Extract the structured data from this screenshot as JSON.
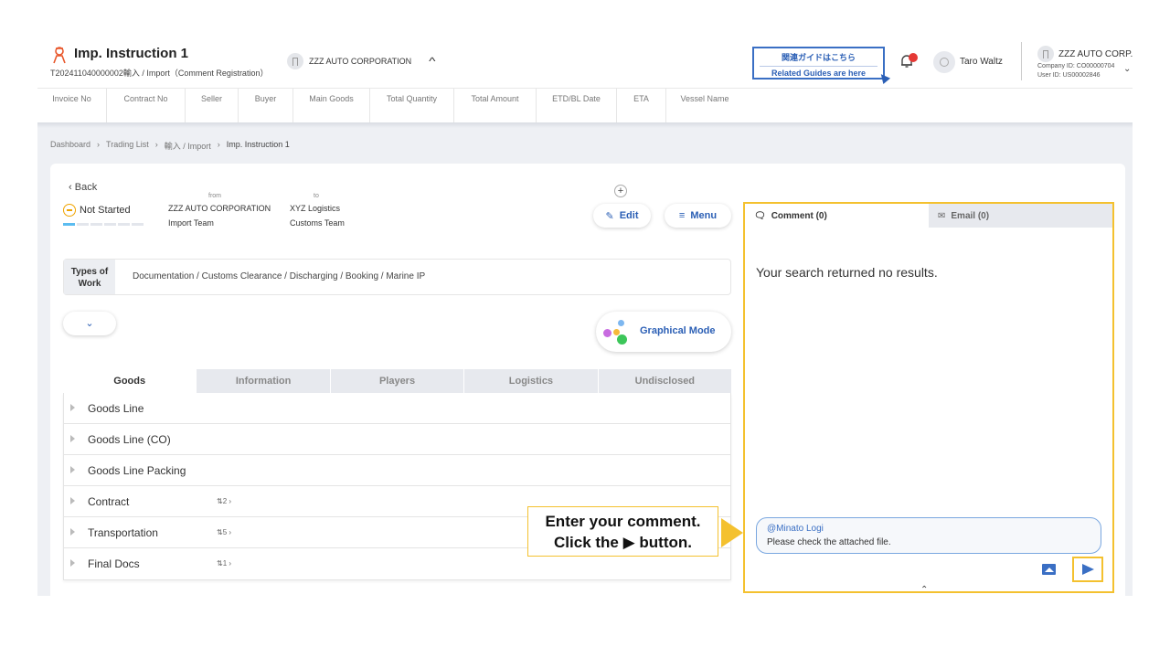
{
  "header": {
    "title": "Imp. Instruction 1",
    "subtitle": "T202411040000002輸入 / Import（Comment Registration）",
    "company_chip": "ZZZ AUTO CORPORATION",
    "guide_jp": "関連ガイドはこちら",
    "guide_en": "Related Guides are here",
    "user_name": "Taro Waltz",
    "company_name": "ZZZ AUTO CORP..",
    "company_id": "Company ID: CO00000704",
    "user_id": "User ID: US00002846"
  },
  "columns": [
    "Invoice No",
    "Contract No",
    "Seller",
    "Buyer",
    "Main Goods",
    "Total Quantity",
    "Total Amount",
    "ETD/BL Date",
    "ETA",
    "Vessel Name"
  ],
  "breadcrumb": [
    "Dashboard",
    "Trading List",
    "輸入 / Import",
    "Imp. Instruction 1"
  ],
  "card": {
    "back": "Back",
    "status": "Not Started",
    "from_label": "from",
    "from_company": "ZZZ AUTO CORPORATION",
    "from_team": "Import Team",
    "to_label": "to",
    "to_company": "XYZ Logistics",
    "to_team": "Customs Team",
    "edit": "Edit",
    "menu": "Menu",
    "types_label": "Types of Work",
    "types_value": "Documentation / Customs Clearance / Discharging / Booking / Marine IP",
    "graphical_mode": "Graphical Mode"
  },
  "tabs": [
    "Goods",
    "Information",
    "Players",
    "Logistics",
    "Undisclosed"
  ],
  "rows": [
    {
      "name": "Goods Line",
      "count": ""
    },
    {
      "name": "Goods Line (CO)",
      "count": ""
    },
    {
      "name": "Goods Line Packing",
      "count": ""
    },
    {
      "name": "Contract",
      "count": "⇅2 ›"
    },
    {
      "name": "Transportation",
      "count": "⇅5 ›"
    },
    {
      "name": "Final Docs",
      "count": "⇅1 ›"
    }
  ],
  "panel": {
    "comment_tab": "Comment (0)",
    "email_tab": "Email (0)",
    "no_results": "Your search returned no results.",
    "mention": "@Minato Logi",
    "comment_text": "Please check the attached file."
  },
  "callout": {
    "line1": "Enter your comment.",
    "line2": "Click the ▶ button."
  },
  "colors": {
    "accent": "#2b5fb5",
    "highlight": "#f4c12f",
    "alert": "#e53935"
  }
}
